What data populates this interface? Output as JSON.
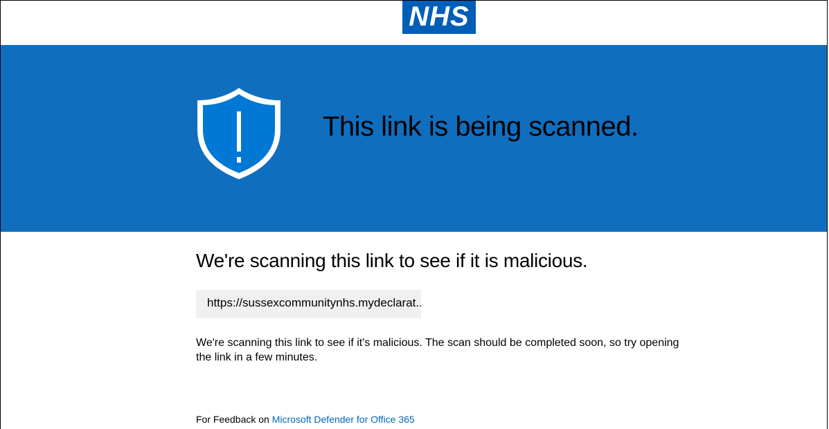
{
  "header": {
    "logo_text": "NHS",
    "logo_color": "#005eb8"
  },
  "banner": {
    "background_color": "#106ebe",
    "icon": "shield-exclamation-icon",
    "title": "This link is being scanned."
  },
  "content": {
    "heading": "We're scanning this link to see if it is malicious.",
    "url": "https://sussexcommunitynhs.mydeclarat...",
    "description": "We're scanning this link to see if it's malicious. The scan should be completed soon, so try opening the link in a few minutes."
  },
  "footer": {
    "feedback_prefix": "For Feedback on ",
    "feedback_link": "Microsoft Defender for Office 365",
    "link_color": "#0067b8"
  }
}
